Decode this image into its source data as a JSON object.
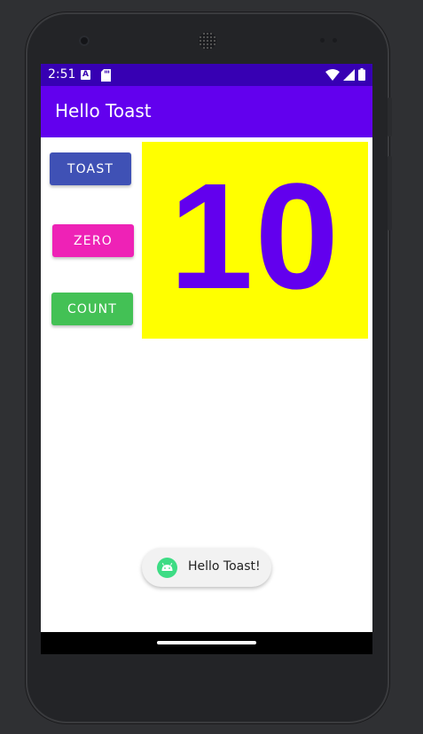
{
  "status_bar": {
    "time": "2:51",
    "a_icon_letter": "A",
    "color": "#3700b3"
  },
  "app_bar": {
    "title": "Hello Toast",
    "color": "#6200ee"
  },
  "buttons": {
    "toast_label": "TOAST",
    "zero_label": "ZERO",
    "count_label": "COUNT",
    "toast_color": "#3f51b5",
    "zero_color": "#ee22b6",
    "count_color": "#43c155"
  },
  "counter": {
    "value": "10",
    "background": "#ffff00",
    "text_color": "#6200ee"
  },
  "toast_popup": {
    "message": "Hello Toast!",
    "icon": "android-icon"
  },
  "icons": [
    "sd-card-icon",
    "wifi-icon",
    "cell-signal-icon",
    "battery-icon"
  ]
}
